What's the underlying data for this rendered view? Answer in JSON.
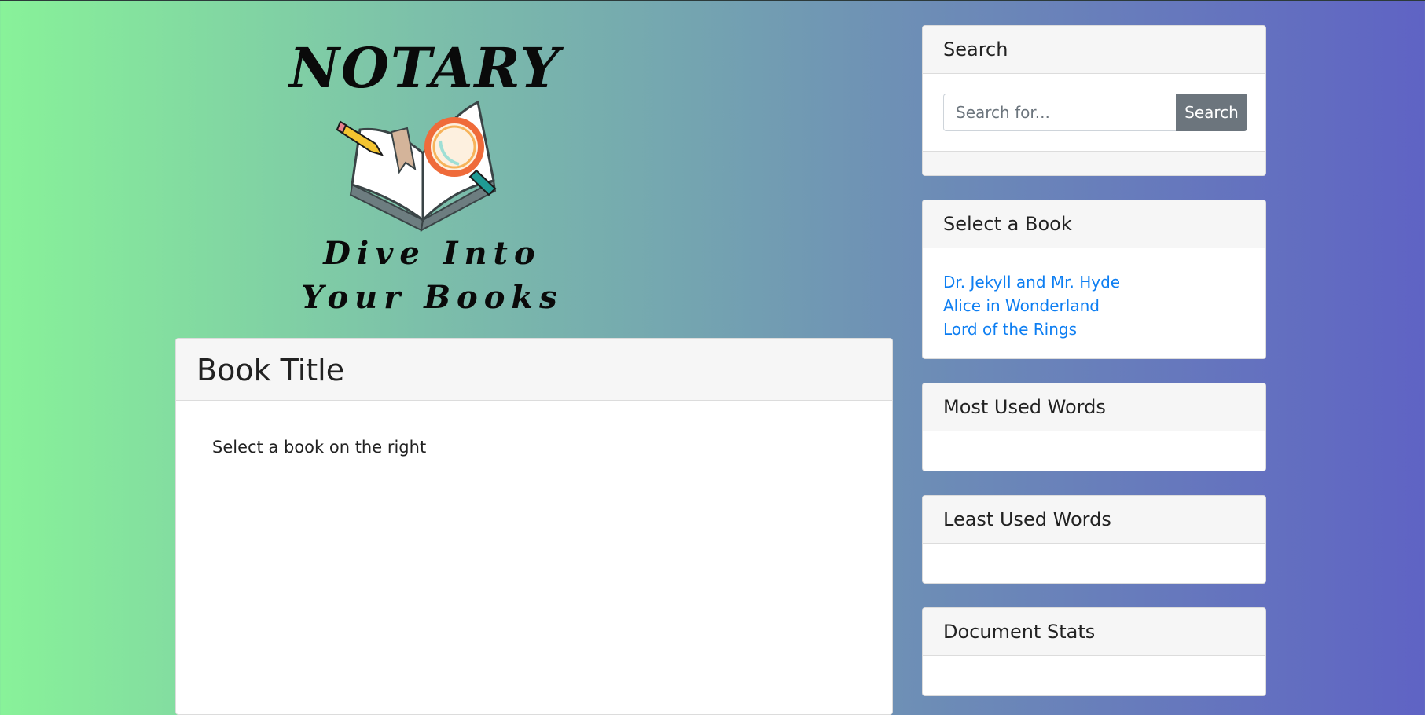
{
  "logo": {
    "brand": "NOTARY",
    "tagline_line1": "Dive Into",
    "tagline_line2": "Your Books"
  },
  "main": {
    "title": "Book Title",
    "body": "Select a book on the right"
  },
  "search": {
    "heading": "Search",
    "placeholder": "Search for...",
    "button_label": "Search"
  },
  "books": {
    "heading": "Select a Book",
    "items": [
      "Dr. Jekyll and Mr. Hyde",
      "Alice in Wonderland",
      "Lord of the Rings"
    ]
  },
  "most_used": {
    "heading": "Most Used Words"
  },
  "least_used": {
    "heading": "Least Used Words"
  },
  "stats": {
    "heading": "Document Stats"
  },
  "colors": {
    "link": "#0d7ef2",
    "button": "#6c757d",
    "gradient_start": "#88f299",
    "gradient_end": "#5f63c4"
  },
  "icons": [
    "book-illustration",
    "pencil-icon",
    "magnifier-icon"
  ]
}
